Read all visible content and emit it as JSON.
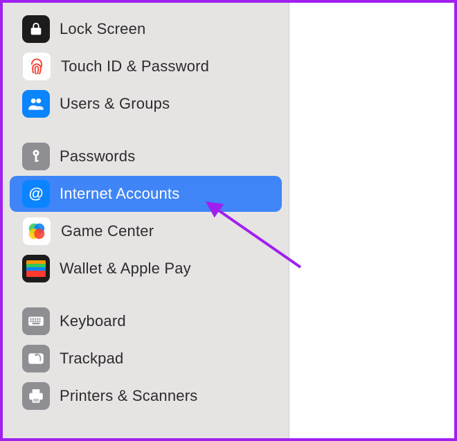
{
  "sidebar": {
    "groups": [
      {
        "items": [
          {
            "id": "lock-screen",
            "label": "Lock Screen"
          },
          {
            "id": "touch-id",
            "label": "Touch ID & Password"
          },
          {
            "id": "users-groups",
            "label": "Users & Groups"
          }
        ]
      },
      {
        "items": [
          {
            "id": "passwords",
            "label": "Passwords"
          },
          {
            "id": "internet-accounts",
            "label": "Internet Accounts",
            "selected": true
          },
          {
            "id": "game-center",
            "label": "Game Center"
          },
          {
            "id": "wallet",
            "label": "Wallet & Apple Pay"
          }
        ]
      },
      {
        "items": [
          {
            "id": "keyboard",
            "label": "Keyboard"
          },
          {
            "id": "trackpad",
            "label": "Trackpad"
          },
          {
            "id": "printers",
            "label": "Printers & Scanners"
          }
        ]
      }
    ]
  },
  "annotation": {
    "arrow_color": "#a020f0",
    "points_to": "internet-accounts"
  }
}
